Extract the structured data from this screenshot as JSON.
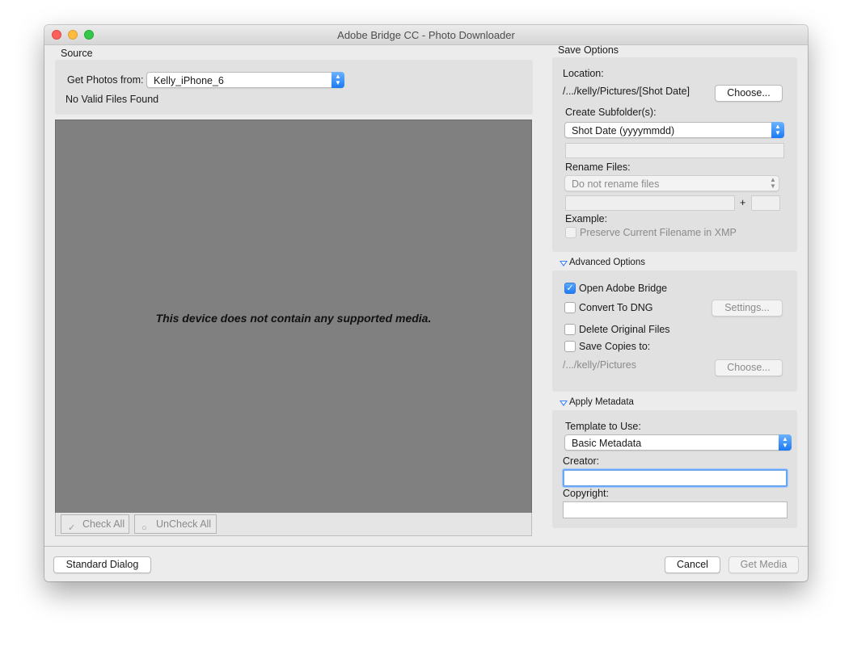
{
  "window": {
    "title": "Adobe Bridge CC - Photo Downloader"
  },
  "source": {
    "section_label": "Source",
    "get_photos_label": "Get Photos from:",
    "device": "Kelly_iPhone_6",
    "status": "No Valid Files Found",
    "preview_message": "This device does not contain any supported media.",
    "check_all": "Check All",
    "uncheck_all": "UnCheck All"
  },
  "save_options": {
    "section_label": "Save Options",
    "location_label": "Location:",
    "location_path": "/.../kelly/Pictures/[Shot Date]",
    "choose_button": "Choose...",
    "subfolder_label": "Create Subfolder(s):",
    "subfolder_value": "Shot Date (yyyymmdd)",
    "rename_label": "Rename Files:",
    "rename_value": "Do not rename files",
    "plus": "+",
    "example_label": "Example:",
    "preserve_label": "Preserve Current Filename in XMP"
  },
  "advanced_options": {
    "section_label": "Advanced Options",
    "open_bridge": "Open Adobe Bridge",
    "open_bridge_checked": true,
    "convert_dng": "Convert To DNG",
    "settings_button": "Settings...",
    "delete_originals": "Delete Original Files",
    "save_copies": "Save Copies to:",
    "copies_path": "/.../kelly/Pictures",
    "choose_button": "Choose..."
  },
  "apply_metadata": {
    "section_label": "Apply Metadata",
    "template_label": "Template to Use:",
    "template_value": "Basic Metadata",
    "creator_label": "Creator:",
    "creator_value": "",
    "copyright_label": "Copyright:",
    "copyright_value": ""
  },
  "footer": {
    "standard_dialog": "Standard Dialog",
    "cancel": "Cancel",
    "get_media": "Get Media"
  }
}
